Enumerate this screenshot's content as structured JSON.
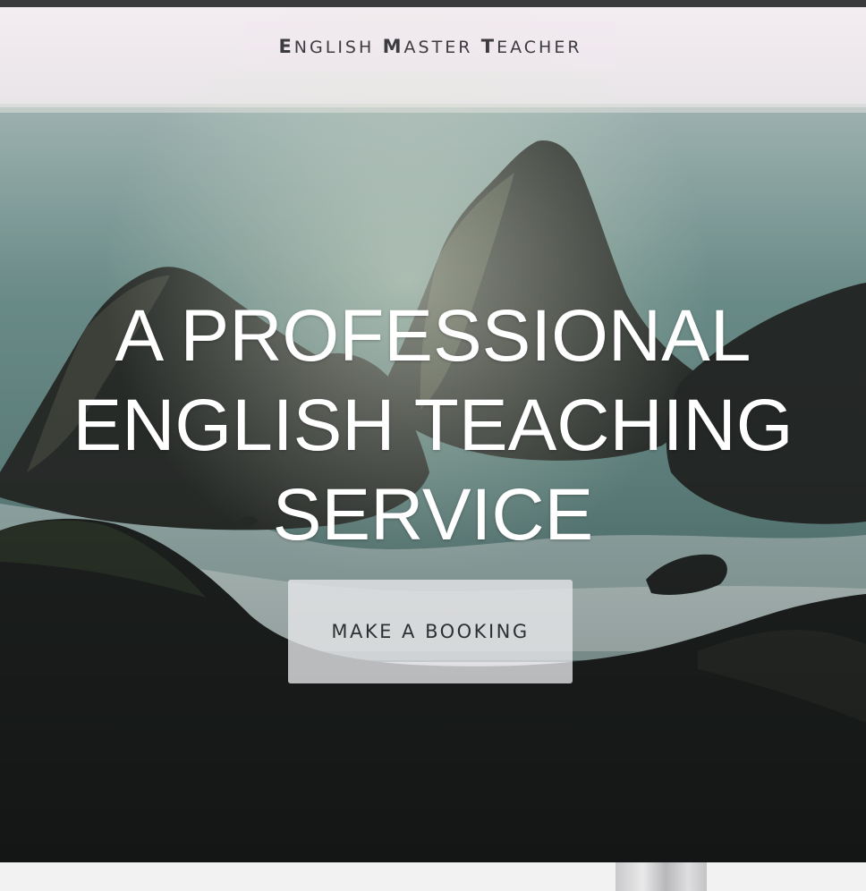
{
  "header": {
    "logo": [
      {
        "cap": "E",
        "rest": "NGLISH"
      },
      {
        "cap": "M",
        "rest": "ASTER"
      },
      {
        "cap": "T",
        "rest": "EACHER"
      }
    ]
  },
  "hero": {
    "headline": "A PROFESSIONAL ENGLISH TEACHING SERVICE",
    "cta_label": "MAKE A BOOKING"
  },
  "colors": {
    "sky": "#efe7ec",
    "sea": "#6f948f",
    "rock": "#1f2322",
    "button_bg": "#e8e8eb",
    "button_text": "#2f3033",
    "headline_text": "#ffffff",
    "top_bar": "#3a3a3c"
  }
}
